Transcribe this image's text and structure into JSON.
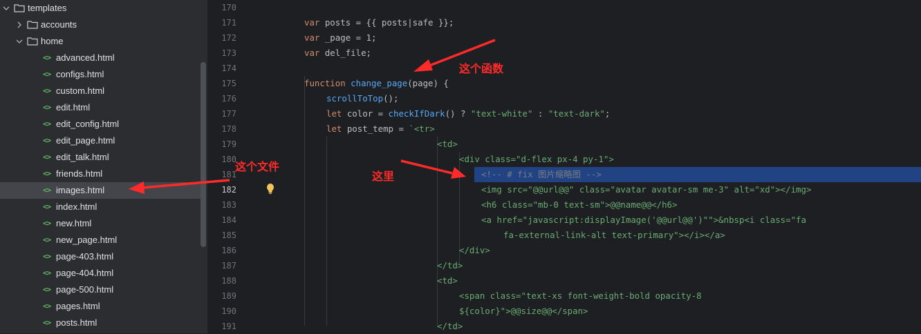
{
  "project_tree": {
    "items": [
      {
        "label": "templates",
        "type": "folder",
        "expanded": true,
        "depth": 0
      },
      {
        "label": "accounts",
        "type": "folder",
        "expanded": false,
        "depth": 1
      },
      {
        "label": "home",
        "type": "folder",
        "expanded": true,
        "depth": 1
      },
      {
        "label": "advanced.html",
        "type": "html",
        "depth": 2
      },
      {
        "label": "configs.html",
        "type": "html",
        "depth": 2
      },
      {
        "label": "custom.html",
        "type": "html",
        "depth": 2
      },
      {
        "label": "edit.html",
        "type": "html",
        "depth": 2
      },
      {
        "label": "edit_config.html",
        "type": "html",
        "depth": 2
      },
      {
        "label": "edit_page.html",
        "type": "html",
        "depth": 2
      },
      {
        "label": "edit_talk.html",
        "type": "html",
        "depth": 2
      },
      {
        "label": "friends.html",
        "type": "html",
        "depth": 2
      },
      {
        "label": "images.html",
        "type": "html",
        "depth": 2,
        "selected": true
      },
      {
        "label": "index.html",
        "type": "html",
        "depth": 2
      },
      {
        "label": "new.html",
        "type": "html",
        "depth": 2
      },
      {
        "label": "new_page.html",
        "type": "html",
        "depth": 2
      },
      {
        "label": "page-403.html",
        "type": "html",
        "depth": 2
      },
      {
        "label": "page-404.html",
        "type": "html",
        "depth": 2
      },
      {
        "label": "page-500.html",
        "type": "html",
        "depth": 2
      },
      {
        "label": "pages.html",
        "type": "html",
        "depth": 2
      },
      {
        "label": "posts.html",
        "type": "html",
        "depth": 2
      }
    ]
  },
  "editor": {
    "current_line": "182",
    "lines": [
      {
        "num": "170",
        "indent": 0,
        "code": ""
      },
      {
        "num": "171",
        "indent": 1,
        "code": "var posts = {{ posts|safe }};"
      },
      {
        "num": "172",
        "indent": 1,
        "code": "var _page = 1;"
      },
      {
        "num": "173",
        "indent": 1,
        "code": "var del_file;"
      },
      {
        "num": "174",
        "indent": 0,
        "code": ""
      },
      {
        "num": "175",
        "indent": 1,
        "code": "function change_page(page) {"
      },
      {
        "num": "176",
        "indent": 2,
        "code": "scrollToTop();"
      },
      {
        "num": "177",
        "indent": 2,
        "code": "let color = checkIfDark() ? \"text-white\" : \"text-dark\";"
      },
      {
        "num": "178",
        "indent": 2,
        "code": "let post_temp = `<tr>"
      },
      {
        "num": "179",
        "indent": 7,
        "code": "<td>"
      },
      {
        "num": "180",
        "indent": 8,
        "code": "<div class=\"d-flex px-4 py-1\">"
      },
      {
        "num": "181",
        "indent": 9,
        "code": "<!-- # fix 图片缩略图 -->"
      },
      {
        "num": "182",
        "indent": 9,
        "code": "<img src=\"@@url@@\" class=\"avatar avatar-sm me-3\" alt=\"xd\"></img>"
      },
      {
        "num": "183",
        "indent": 9,
        "code": "<h6 class=\"mb-0 text-sm\">@@name@@</h6>"
      },
      {
        "num": "184",
        "indent": 9,
        "code": "<a href=\"javascript:displayImage('@@url@@')\"\">&nbsp<i class=\"fa"
      },
      {
        "num": "185",
        "indent": 10,
        "code": "fa-external-link-alt text-primary\"></i></a>"
      },
      {
        "num": "186",
        "indent": 8,
        "code": "</div>"
      },
      {
        "num": "187",
        "indent": 7,
        "code": "</td>"
      },
      {
        "num": "188",
        "indent": 7,
        "code": "<td>"
      },
      {
        "num": "189",
        "indent": 8,
        "code": "<span class=\"text-xs font-weight-bold opacity-8"
      },
      {
        "num": "190",
        "indent": 8,
        "code": "${color}\">@@size@@</span>"
      },
      {
        "num": "191",
        "indent": 7,
        "code": "</td>"
      }
    ]
  },
  "annotations": {
    "this_function": "这个函数",
    "this_file": "这个文件",
    "here": "这里"
  },
  "colors": {
    "annotation": "#ff2a2a",
    "selection": "#214283",
    "keyword": "#cf8e6d",
    "string": "#6aab73",
    "tag": "#d5b778",
    "comment": "#7a7e85",
    "function": "#56a8f5"
  }
}
